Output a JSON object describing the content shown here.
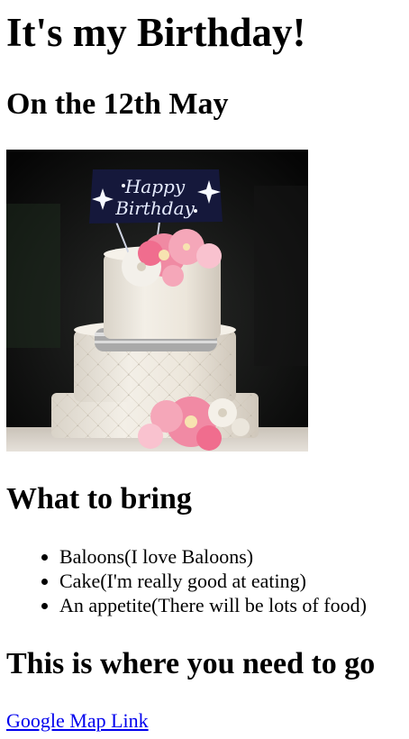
{
  "page": {
    "title": "It's my Birthday!",
    "date_heading": "On the 12th May",
    "cake_topper_text": "Happy Birthday"
  },
  "bring": {
    "heading": "What to bring",
    "items": [
      "Baloons(I love Baloons)",
      "Cake(I'm really good at eating)",
      "An appetite(There will be lots of food)"
    ]
  },
  "location": {
    "heading": "This is where you need to go",
    "link_text": "Google Map Link"
  },
  "colors": {
    "link": "#0000ee",
    "text": "#000000",
    "background": "#ffffff"
  }
}
